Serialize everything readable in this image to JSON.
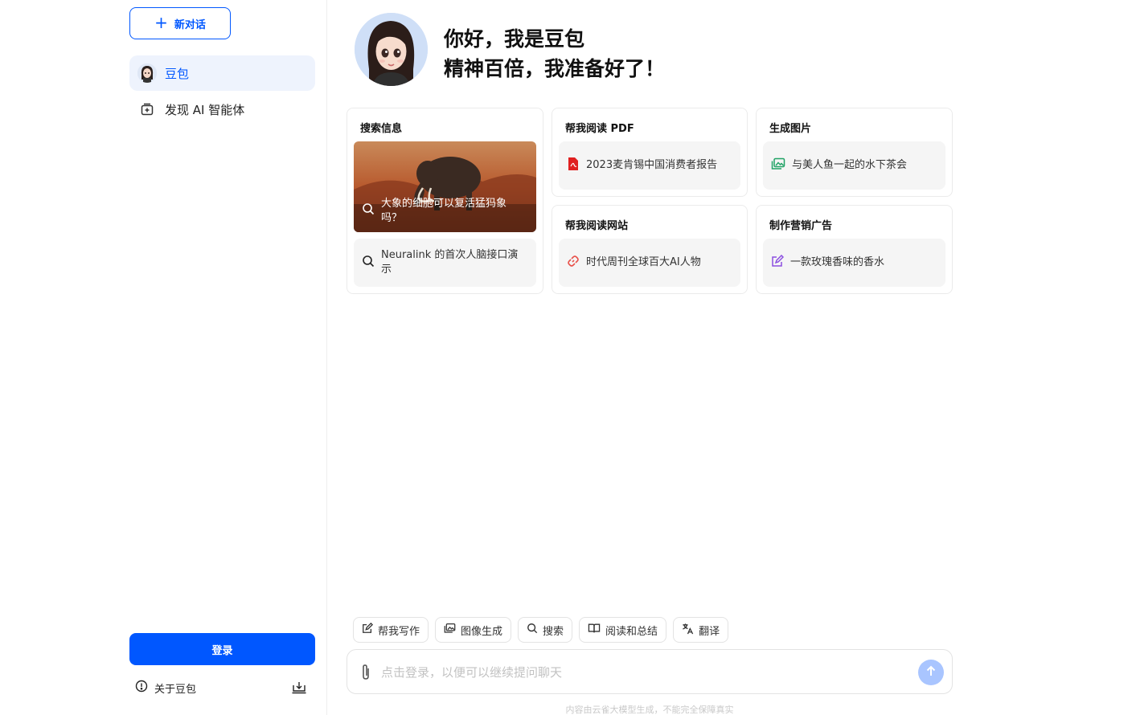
{
  "sidebar": {
    "new_chat_label": "新对话",
    "items": [
      {
        "label": "豆包",
        "icon": "doubao-avatar-icon",
        "active": true
      },
      {
        "label": "发现 AI 智能体",
        "icon": "discover-agent-icon",
        "active": false
      }
    ],
    "login_label": "登录",
    "about_label": "关于豆包"
  },
  "main": {
    "greeting_line1": "你好，我是豆包",
    "greeting_line2": "精神百倍，我准备好了！",
    "cards": {
      "search": {
        "title": "搜索信息",
        "featured": "大象的细胞可以复活猛犸象吗？",
        "item": "Neuralink 的首次人脑接口演示"
      },
      "pdf": {
        "title": "帮我阅读 PDF",
        "item": "2023麦肯锡中国消费者报告"
      },
      "image": {
        "title": "生成图片",
        "item": "与美人鱼一起的水下茶会"
      },
      "website": {
        "title": "帮我阅读网站",
        "item": "时代周刊全球百大AI人物"
      },
      "ad": {
        "title": "制作营销广告",
        "item": "一款玫瑰香味的香水"
      }
    }
  },
  "toolbar": {
    "tools": [
      "帮我写作",
      "图像生成",
      "搜索",
      "阅读和总结",
      "翻译"
    ]
  },
  "input": {
    "placeholder": "点击登录，以便可以继续提问聊天",
    "value": ""
  },
  "disclaimer": "内容由云雀大模型生成，不能完全保障真实",
  "colors": {
    "accent": "#0057ff",
    "pdf_red": "#e02020",
    "image_green": "#21a366",
    "link_red": "#e8514a",
    "edit_purple": "#8b4fe0"
  }
}
